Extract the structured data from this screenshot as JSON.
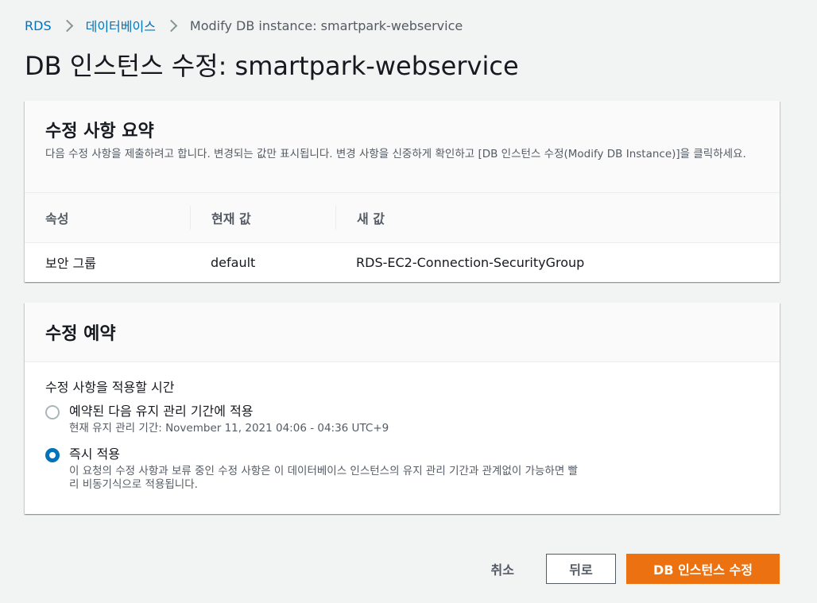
{
  "breadcrumb": {
    "items": [
      "RDS",
      "데이터베이스"
    ],
    "current": "Modify DB instance: smartpark-webservice"
  },
  "page_title": "DB 인스턴스 수정: smartpark-webservice",
  "summary": {
    "title": "수정 사항 요약",
    "description": "다음 수정 사항을 제출하려고 합니다. 변경되는 값만 표시됩니다. 변경 사항을 신중하게 확인하고 [DB 인스턴스 수정(Modify DB Instance)]을 클릭하세요.",
    "columns": [
      "속성",
      "현재 값",
      "새 값"
    ],
    "rows": [
      {
        "attribute": "보안 그룹",
        "current": "default",
        "new": "RDS-EC2-Connection-SecurityGroup"
      }
    ]
  },
  "schedule": {
    "title": "수정 예약",
    "field_label": "수정 사항을 적용할 시간",
    "options": [
      {
        "label": "예약된 다음 유지 관리 기간에 적용",
        "description": "현재 유지 관리 기간: November 11, 2021 04:06 - 04:36 UTC+9",
        "selected": false
      },
      {
        "label": "즉시 적용",
        "description": "이 요청의 수정 사항과 보류 중인 수정 사항은 이 데이터베이스 인스턴스의 유지 관리 기간과 관계없이 가능하면 빨리 비동기식으로 적용됩니다.",
        "selected": true
      }
    ]
  },
  "actions": {
    "cancel_label": "취소",
    "back_label": "뒤로",
    "submit_label": "DB 인스턴스 수정"
  },
  "colors": {
    "primary": "#ec7211",
    "link": "#0073bb",
    "background": "#f2f3f3"
  }
}
